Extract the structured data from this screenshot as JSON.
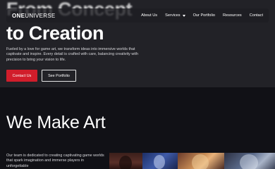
{
  "hero": {
    "title_line_1": "From Concept",
    "title_line_2": "to Creation",
    "description": "Fueled by a love for game art, we transform ideas into immersive worlds that captivate and inspire. Every detail is crafted with care, balancing creativity with precision to bring your vision to life.",
    "primary_button": "Contact Us",
    "secondary_button": "See Portfolio"
  },
  "nav": {
    "logo_bold": "ONE",
    "logo_regular": "UNIVERSE",
    "links": [
      "About Us",
      "Services",
      "Our Portfolio",
      "Resources",
      "Contact"
    ]
  },
  "section": {
    "title": "We Make Art",
    "description": "Our team is dedicated to creating captivating game worlds that spark imagination and immerse players in unforgettable"
  },
  "colors": {
    "accent": "#d11d2b",
    "hero_bg": "#222227",
    "page_bg": "#111116"
  }
}
